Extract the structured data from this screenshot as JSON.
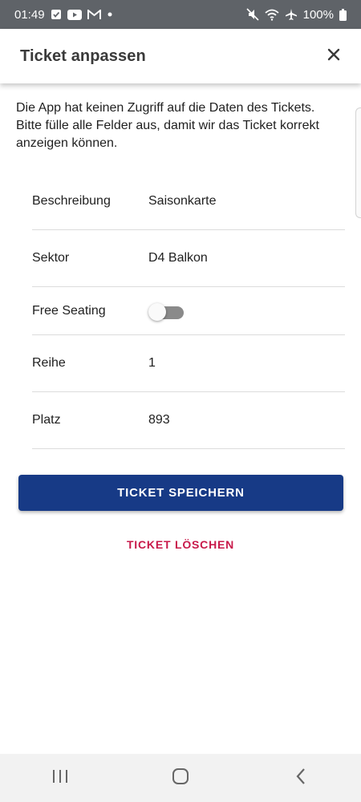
{
  "status_bar": {
    "time": "01:49",
    "battery": "100%",
    "icons_left": [
      "check-icon",
      "youtube-icon",
      "gmail-icon",
      "dot-icon"
    ],
    "icons_right": [
      "mute-icon",
      "wifi-icon",
      "airplane-icon",
      "battery-icon"
    ]
  },
  "app_bar": {
    "title": "Ticket anpassen",
    "close_icon": "close-icon"
  },
  "intro_text": "Die App hat keinen Zugriff auf die Daten des Tickets. Bitte fülle alle Felder aus, damit wir das Ticket korrekt anzeigen können.",
  "form": {
    "beschreibung": {
      "label": "Beschreibung",
      "value": "Saisonkarte"
    },
    "sektor": {
      "label": "Sektor",
      "value": "D4 Balkon"
    },
    "free_seating": {
      "label": "Free Seating",
      "enabled": false
    },
    "reihe": {
      "label": "Reihe",
      "value": "1"
    },
    "platz": {
      "label": "Platz",
      "value": "893"
    }
  },
  "actions": {
    "save_label": "TICKET SPEICHERN",
    "delete_label": "TICKET LÖSCHEN"
  },
  "colors": {
    "primary": "#173a86",
    "danger": "#c8194a",
    "status_bar": "#5f6368",
    "toggle_off": "#8a8a8a"
  },
  "nav_bar": {
    "icons": [
      "recent-apps-icon",
      "home-icon",
      "back-icon"
    ]
  }
}
